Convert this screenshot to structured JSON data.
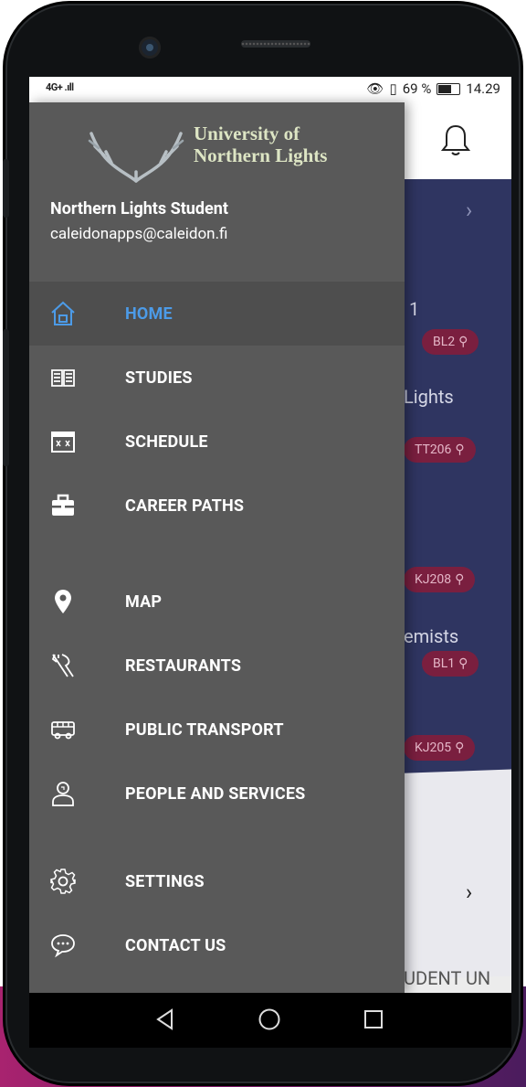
{
  "status": {
    "signal": "4G+",
    "battery_percent": "69 %",
    "time": "14.29"
  },
  "drawer": {
    "logo_line1": "University of",
    "logo_line2": "Northern Lights",
    "user_name": "Northern Lights Student",
    "user_email": "caleidonapps@caleidon.fi",
    "items": [
      {
        "label": "HOME",
        "icon": "home-icon",
        "active": true
      },
      {
        "label": "STUDIES",
        "icon": "book-icon"
      },
      {
        "label": "SCHEDULE",
        "icon": "calendar-icon"
      },
      {
        "label": "CAREER PATHS",
        "icon": "briefcase-icon"
      },
      {
        "label": "MAP",
        "icon": "map-pin-icon"
      },
      {
        "label": "RESTAURANTS",
        "icon": "cutlery-icon"
      },
      {
        "label": "PUBLIC TRANSPORT",
        "icon": "bus-icon"
      },
      {
        "label": "PEOPLE AND SERVICES",
        "icon": "person-icon"
      },
      {
        "label": "SETTINGS",
        "icon": "gear-icon"
      },
      {
        "label": "CONTACT US",
        "icon": "chat-icon"
      }
    ]
  },
  "background": {
    "text1": "1",
    "text2": "Lights",
    "text3": "emists",
    "chips": [
      "BL2",
      "TT206",
      "KJ208",
      "BL1",
      "KJ205"
    ],
    "footer_text": "UDENT UN"
  },
  "colors": {
    "drawer_bg": "#595959",
    "active_item_bg": "#4e4e4e",
    "active_accent": "#4c9be8",
    "app_content_bg": "#2f3561",
    "chip_bg": "#7a1f3f"
  }
}
